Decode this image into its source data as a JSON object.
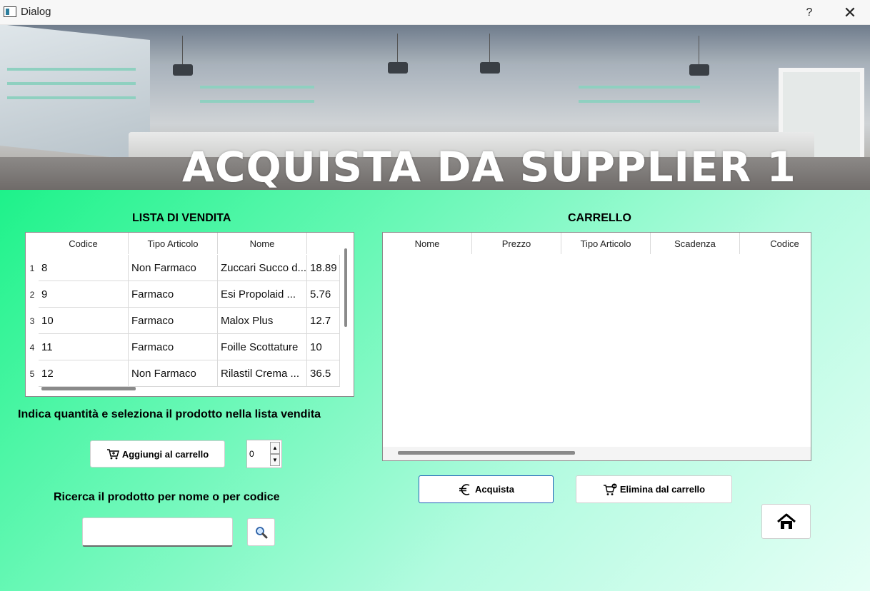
{
  "window": {
    "title": "Dialog",
    "help": "?",
    "close": "✕"
  },
  "banner": {
    "headline": "ACQUISTA DA SUPPLIER 1"
  },
  "left": {
    "title": "LISTA DI VENDITA",
    "headers": [
      "Codice",
      "Tipo Articolo",
      "Nome",
      ""
    ],
    "rows": [
      {
        "n": "1",
        "cells": [
          "8",
          "Non Farmaco",
          "Zuccari Succo d...",
          "18.89"
        ]
      },
      {
        "n": "2",
        "cells": [
          "9",
          "Farmaco",
          "Esi Propolaid ...",
          "5.76"
        ]
      },
      {
        "n": "3",
        "cells": [
          "10",
          "Farmaco",
          "Malox Plus",
          "12.7"
        ]
      },
      {
        "n": "4",
        "cells": [
          "11",
          "Farmaco",
          "Foille Scottature",
          "10"
        ]
      },
      {
        "n": "5",
        "cells": [
          "12",
          "Non Farmaco",
          "Rilastil Crema ...",
          "36.5"
        ]
      }
    ],
    "instruction": "Indica quantità e seleziona il prodotto nella lista vendita",
    "add_button": "Aggiungi al carrello",
    "quantity": "0",
    "search_label": "Ricerca il prodotto per nome o per codice",
    "search_value": ""
  },
  "right": {
    "title": "CARRELLO",
    "headers": [
      "Nome",
      "Prezzo",
      "Tipo Articolo",
      "Scadenza",
      "Codice"
    ],
    "buy_button": "Acquista",
    "remove_button": "Elimina dal carrello"
  },
  "icons": {
    "cart": "cart-icon",
    "euro": "euro-icon",
    "cart_remove": "cart-remove-icon",
    "search": "magnifier-icon",
    "home": "home-icon"
  }
}
